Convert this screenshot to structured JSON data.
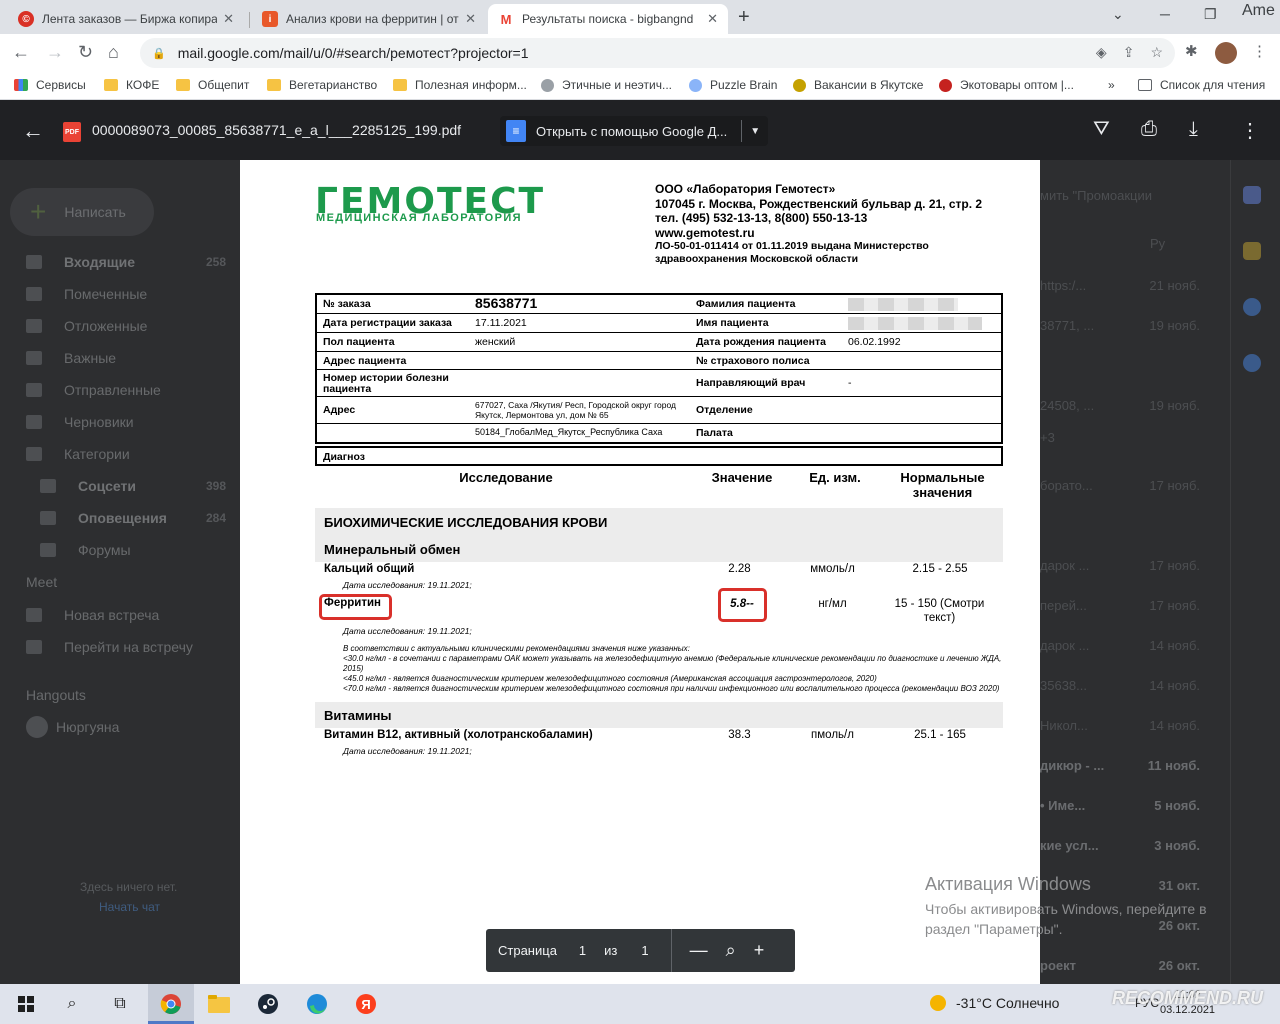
{
  "tabs": [
    {
      "title": "Лента заказов — Биржа копирайтинга",
      "icon": "copyright-icon",
      "active": false
    },
    {
      "title": "Анализ крови на ферритин | отзывы",
      "icon": "recommend-icon",
      "active": false
    },
    {
      "title": "Результаты поиска - bigbangnd",
      "icon": "gmail-icon",
      "active": true
    }
  ],
  "window": {
    "user_label": "Ame"
  },
  "address": {
    "url": "mail.google.com/mail/u/0/#search/ремотест?projector=1"
  },
  "bookmarks": [
    {
      "label": "Сервисы",
      "icon": "apps-icon"
    },
    {
      "label": "КОФЕ",
      "icon": "folder-icon"
    },
    {
      "label": "Общепит",
      "icon": "folder-icon"
    },
    {
      "label": "Вегетарианство",
      "icon": "folder-icon"
    },
    {
      "label": "Полезная информ...",
      "icon": "folder-icon"
    },
    {
      "label": "Этичные и неэтич...",
      "icon": "leaf-icon"
    },
    {
      "label": "Puzzle Brain",
      "icon": "globe-icon"
    },
    {
      "label": "Вакансии в Якутске",
      "icon": "coin-icon"
    },
    {
      "label": "Экотовары оптом |...",
      "icon": "dots-icon"
    },
    {
      "label": "»",
      "icon": ""
    },
    {
      "label": "Список для чтения",
      "icon": "reading-list-icon"
    }
  ],
  "gmail": {
    "compose": "Написать",
    "side": [
      {
        "label": "Входящие",
        "count": "258",
        "bold": true
      },
      {
        "label": "Помеченные",
        "count": ""
      },
      {
        "label": "Отложенные",
        "count": ""
      },
      {
        "label": "Важные",
        "count": ""
      },
      {
        "label": "Отправленные",
        "count": ""
      },
      {
        "label": "Черновики",
        "count": ""
      },
      {
        "label": "Категории",
        "count": ""
      },
      {
        "label": "Соцсети",
        "count": "398",
        "bold": true
      },
      {
        "label": "Оповещения",
        "count": "284",
        "bold": true
      },
      {
        "label": "Форумы",
        "count": ""
      }
    ],
    "meet_title": "Meet",
    "meet": [
      "Новая встреча",
      "Перейти на встречу"
    ],
    "hangouts_title": "Hangouts",
    "hangouts_user": "Нюргуяна",
    "empty_text": "Здесь ничего нет.",
    "start_chat": "Начать чат",
    "right_header": "мить \"Промоакции",
    "right_tab": "Ру",
    "right_rows": [
      {
        "text": "https:/...",
        "date": "21 нояб.",
        "bold": false
      },
      {
        "text": "38771, ...",
        "date": "19 нояб.",
        "bold": false
      },
      {
        "text": "24508, ...",
        "date": "19 нояб.",
        "bold": false
      },
      {
        "text": "+3",
        "date": "",
        "bold": false
      },
      {
        "text": "борато...",
        "date": "17 нояб.",
        "bold": false
      },
      {
        "text": "дарок ...",
        "date": "17 нояб.",
        "bold": false
      },
      {
        "text": "перей...",
        "date": "17 нояб.",
        "bold": false
      },
      {
        "text": "дарок ...",
        "date": "14 нояб.",
        "bold": false
      },
      {
        "text": "35638...",
        "date": "14 нояб.",
        "bold": false
      },
      {
        "text": "Никол...",
        "date": "14 нояб.",
        "bold": false
      },
      {
        "text": "дикюр - ...",
        "date": "11 нояб.",
        "bold": true
      },
      {
        "text": "• Име...",
        "date": "5 нояб.",
        "bold": true
      },
      {
        "text": "кие усл...",
        "date": "3 нояб.",
        "bold": true
      },
      {
        "text": "",
        "date": "31 окт.",
        "bold": true
      },
      {
        "text": "",
        "date": "26 окт.",
        "bold": true
      },
      {
        "text": "роект",
        "date": "26 окт.",
        "bold": true
      }
    ]
  },
  "pdf": {
    "filename": "0000089073_00085_85638771_e_a_l___2285125_199.pdf",
    "open_with": "Открыть с помощью Google Д...",
    "file_badge": "PDF"
  },
  "lab": {
    "logo": "ГЕМОТЕСТ",
    "logo_sub": "МЕДИЦИНСКАЯ ЛАБОРАТОРИЯ",
    "org": "ООО «Лаборатория Гемотест»",
    "address": "107045 г. Москва, Рождественский бульвар д. 21, стр. 2",
    "phone": "тел. (495) 532-13-13, 8(800) 550-13-13",
    "site": "www.gemotest.ru",
    "license1": "ЛО-50-01-011414 от 01.11.2019 выдана Министерство",
    "license2": "здравоохранения Московской области"
  },
  "patient": {
    "order_label": "№ заказа",
    "order": "85638771",
    "surname_label": "Фамилия пациента",
    "reg_label": "Дата регистрации заказа",
    "reg": "17.11.2021",
    "name_label": "Имя пациента",
    "sex_label": "Пол пациента",
    "sex": "женский",
    "dob_label": "Дата рождения пациента",
    "dob": "06.02.1992",
    "addr_label": "Адрес пациента",
    "policy_label": "№ страхового полиса",
    "history_label": "Номер истории болезни пациента",
    "doctor_label": "Направляющий врач",
    "doctor": "-",
    "address_label": "Адрес",
    "address": "677027, Саха /Якутия/ Респ, Городской округ город Якутск, Лермонтова ул, дом № 65",
    "dept_label": "Отделение",
    "clinic": "50184_ГлобалМед_Якутск_Республика Саха",
    "ward_label": "Палата",
    "diag_label": "Диагноз"
  },
  "results": {
    "h_test": "Исследование",
    "h_value": "Значение",
    "h_unit": "Ед. изм.",
    "h_norm": "Нормальные значения",
    "section": "БИОХИМИЧЕСКИЕ ИССЛЕДОВАНИЯ КРОВИ",
    "sub1": "Минеральный обмен",
    "calcium": {
      "name": "Кальций общий",
      "value": "2.28",
      "unit": "ммоль/л",
      "norm": "2.15 - 2.55",
      "date": "Дата исследования: 19.11.2021;"
    },
    "ferritin": {
      "name": "Ферритин",
      "value": "5.8--",
      "unit": "нг/мл",
      "norm1": "15 - 150 (Смотри",
      "norm2": "текст)",
      "date": "Дата исследования: 19.11.2021;"
    },
    "note": [
      "В соответствии с актуальными клиническими рекомендациями значения ниже указанных:",
      "<30.0 нг/мл - в сочетании с параметрами ОАК может указывать на железодефицитную анемию (Федеральные клинические рекомендации по диагностике и лечению ЖДА, 2015)",
      "<45.0 нг/мл - является диагностическим критерием железодефицитного состояния (Американская ассоциация гастроэнтерологов, 2020)",
      "<70.0 нг/мл - является диагностическим критерием железодефицитного состояния при наличии инфекционного или воспалительного процесса (рекомендации ВОЗ 2020)"
    ],
    "sub2": "Витамины",
    "b12": {
      "name": "Витамин B12, активный (холотранскобаламин)",
      "value": "38.3",
      "unit": "пмоль/л",
      "norm": "25.1 - 165",
      "date": "Дата исследования: 19.11.2021;"
    }
  },
  "pager": {
    "label": "Страница",
    "current": "1",
    "of": "из",
    "total": "1"
  },
  "activation": {
    "title": "Активация Windows",
    "text1": "Чтобы активировать Windows, перейдите в",
    "text2": "раздел \"Параметры\"."
  },
  "taskbar": {
    "weather": "-31°C Солнечно",
    "lang": "РУС",
    "time": "11:02",
    "date": "03.12.2021",
    "watermark": "RECOMMEND.RU"
  }
}
